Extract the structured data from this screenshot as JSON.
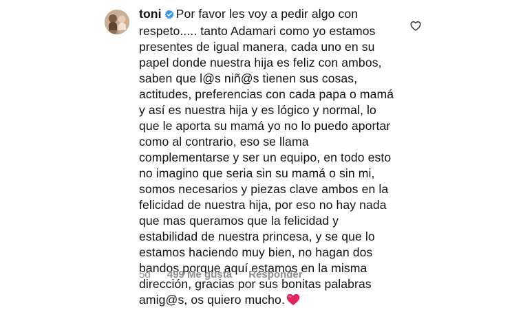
{
  "comment": {
    "username": "toni",
    "verified_icon": "verified-badge-icon",
    "lines": [
      "Por favor les voy a pedir algo con",
      "respeto..... tanto Adamari como yo estamos",
      "presentes de igual manera, cada uno en su",
      "papel donde nuestra hija es feliz con ambos,",
      "saben que l@s niñ@s tienen sus cosas,",
      "actitudes, preferencias con cada papa o mamá",
      "y así es nuestra hija y es lógico y normal, lo",
      "que le aporta su mamá yo no lo puedo aportar",
      "como al contrario, eso se llama",
      "complementarse y ser un equipo, en todo esto",
      "no imagino que seria sin su mamá o sin mi,",
      "somos necesarios y piezas clave ambos en la",
      "felicidad de nuestra hija, por eso no hay nada",
      "que mas queramos que la felicidad y",
      "estabilidad de nuestra princesa, y se que lo",
      "estamos haciendo muy bien, no hagan dos",
      "bandos porque aquí estamos en la misma",
      "dirección, gracias por sus bonitas palabras",
      "amig@s, os quiero mucho."
    ],
    "end_emoji": "red-heart-icon",
    "meta": {
      "age": "5d",
      "likes": "499 Me gusta",
      "reply": "Responder"
    },
    "like_icon": "heart-outline-icon"
  },
  "colors": {
    "text": "#111111",
    "muted": "#8e8e8e",
    "verified": "#3897f0",
    "heart": "#e0245e"
  }
}
